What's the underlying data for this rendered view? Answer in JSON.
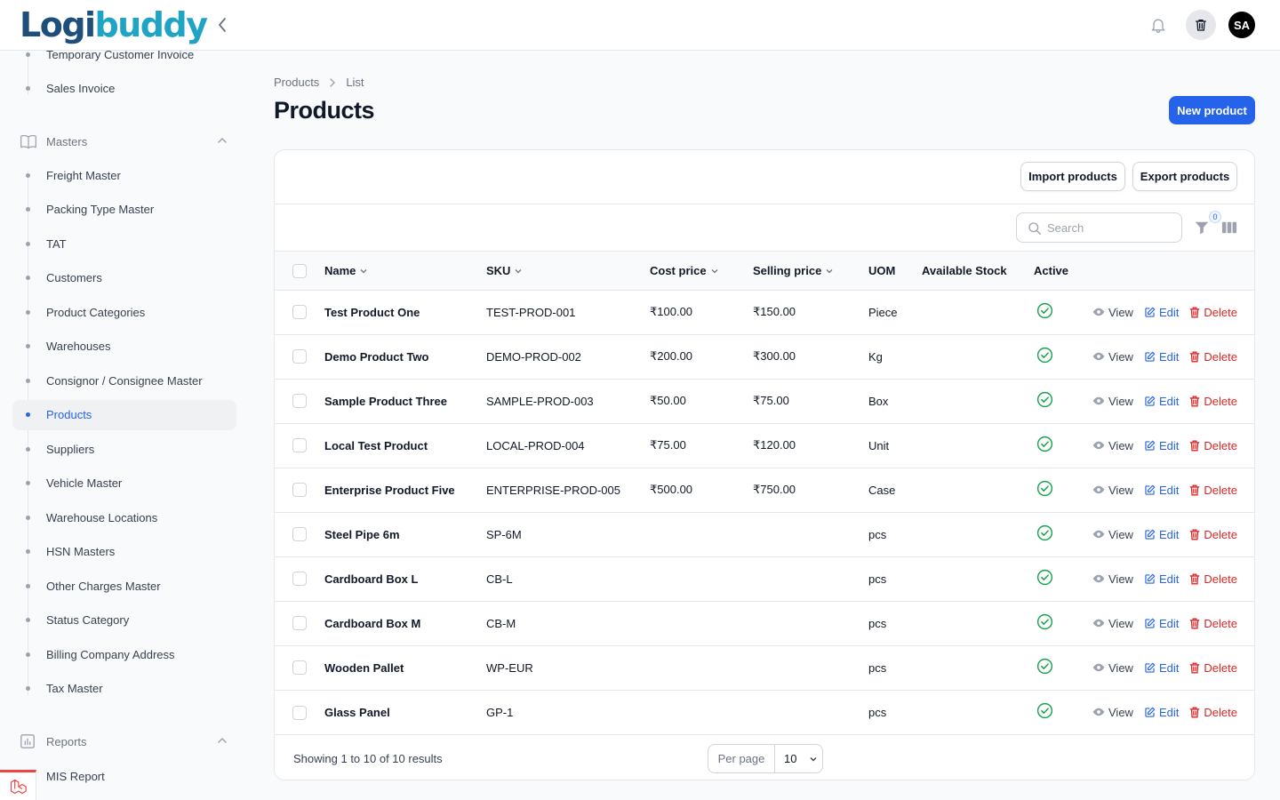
{
  "app": {
    "logo_text_1": "Logi",
    "logo_text_2": "buddy",
    "user_initials": "SA"
  },
  "sidebar": {
    "top_items": [
      {
        "label": "Temporary Customer Invoice"
      },
      {
        "label": "Sales Invoice"
      }
    ],
    "masters_group": "Masters",
    "masters_items": [
      {
        "label": "Freight Master"
      },
      {
        "label": "Packing Type Master"
      },
      {
        "label": "TAT"
      },
      {
        "label": "Customers"
      },
      {
        "label": "Product Categories"
      },
      {
        "label": "Warehouses"
      },
      {
        "label": "Consignor / Consignee Master"
      },
      {
        "label": "Products",
        "active": true
      },
      {
        "label": "Suppliers"
      },
      {
        "label": "Vehicle Master"
      },
      {
        "label": "Warehouse Locations"
      },
      {
        "label": "HSN Masters"
      },
      {
        "label": "Other Charges Master"
      },
      {
        "label": "Status Category"
      },
      {
        "label": "Billing Company Address"
      },
      {
        "label": "Tax Master"
      }
    ],
    "reports_group": "Reports",
    "reports_items": [
      {
        "label": "MIS Report"
      }
    ]
  },
  "breadcrumb": {
    "parent": "Products",
    "current": "List"
  },
  "page": {
    "title": "Products",
    "new_button": "New product"
  },
  "header_actions": {
    "import": "Import products",
    "export": "Export products"
  },
  "toolbar": {
    "search_placeholder": "Search",
    "filter_count": "0"
  },
  "table": {
    "columns": {
      "name": "Name",
      "sku": "SKU",
      "cost": "Cost price",
      "selling": "Selling price",
      "uom": "UOM",
      "stock": "Available Stock",
      "active": "Active"
    },
    "action_labels": {
      "view": "View",
      "edit": "Edit",
      "delete": "Delete"
    },
    "rows": [
      {
        "name": "Test Product One",
        "sku": "TEST-PROD-001",
        "cost": "₹100.00",
        "selling": "₹150.00",
        "uom": "Piece",
        "stock": "",
        "active": true
      },
      {
        "name": "Demo Product Two",
        "sku": "DEMO-PROD-002",
        "cost": "₹200.00",
        "selling": "₹300.00",
        "uom": "Kg",
        "stock": "",
        "active": true
      },
      {
        "name": "Sample Product Three",
        "sku": "SAMPLE-PROD-003",
        "cost": "₹50.00",
        "selling": "₹75.00",
        "uom": "Box",
        "stock": "",
        "active": true
      },
      {
        "name": "Local Test Product",
        "sku": "LOCAL-PROD-004",
        "cost": "₹75.00",
        "selling": "₹120.00",
        "uom": "Unit",
        "stock": "",
        "active": true
      },
      {
        "name": "Enterprise Product Five",
        "sku": "ENTERPRISE-PROD-005",
        "cost": "₹500.00",
        "selling": "₹750.00",
        "uom": "Case",
        "stock": "",
        "active": true
      },
      {
        "name": "Steel Pipe 6m",
        "sku": "SP-6M",
        "cost": "",
        "selling": "",
        "uom": "pcs",
        "stock": "",
        "active": true
      },
      {
        "name": "Cardboard Box L",
        "sku": "CB-L",
        "cost": "",
        "selling": "",
        "uom": "pcs",
        "stock": "",
        "active": true
      },
      {
        "name": "Cardboard Box M",
        "sku": "CB-M",
        "cost": "",
        "selling": "",
        "uom": "pcs",
        "stock": "",
        "active": true
      },
      {
        "name": "Wooden Pallet",
        "sku": "WP-EUR",
        "cost": "",
        "selling": "",
        "uom": "pcs",
        "stock": "",
        "active": true
      },
      {
        "name": "Glass Panel",
        "sku": "GP-1",
        "cost": "",
        "selling": "",
        "uom": "pcs",
        "stock": "",
        "active": true
      }
    ]
  },
  "footer": {
    "showing": "Showing 1 to 10 of 10 results",
    "per_page_label": "Per page",
    "per_page_value": "10"
  },
  "colors": {
    "primary": "#2563eb",
    "danger": "#dc2626",
    "success": "#16a34a"
  }
}
